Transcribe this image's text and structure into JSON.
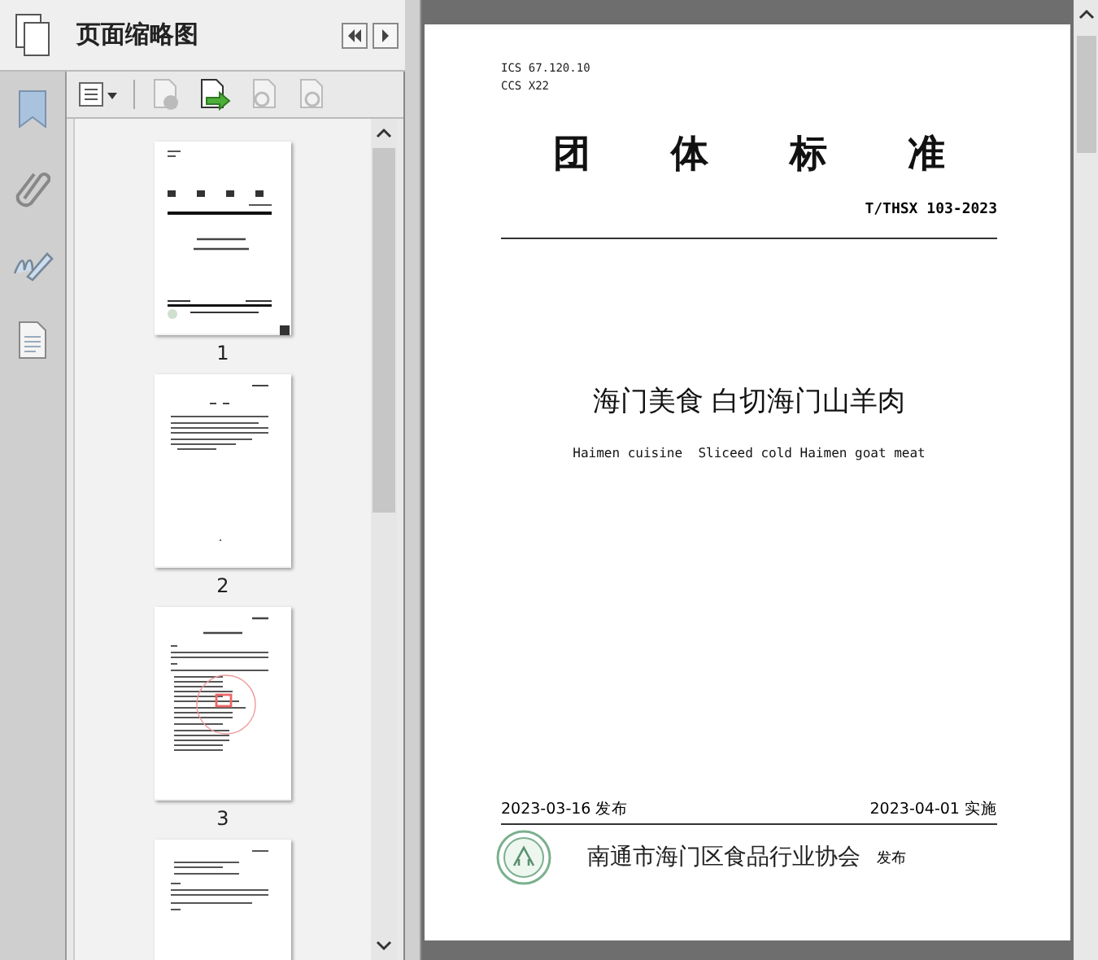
{
  "panel": {
    "title": "页面缩略图"
  },
  "thumbnails": [
    {
      "label": "1",
      "kind": "cover"
    },
    {
      "label": "2",
      "kind": "preface"
    },
    {
      "label": "3",
      "kind": "stamped"
    },
    {
      "kind": "text"
    }
  ],
  "document": {
    "ics": "ICS 67.120.10",
    "ccs": "CCS X22",
    "heading": [
      "团",
      "体",
      "标",
      "准"
    ],
    "code": "T/THSX 103-2023",
    "title": "海门美食 白切海门山羊肉",
    "subtitle": "Haimen cuisine  Sliceed cold Haimen goat meat",
    "issue_date": "2023-03-16 发布",
    "effective_date": "2023-04-01 实施",
    "publisher": "南通市海门区食品行业协会",
    "publisher_suffix": "发布"
  }
}
